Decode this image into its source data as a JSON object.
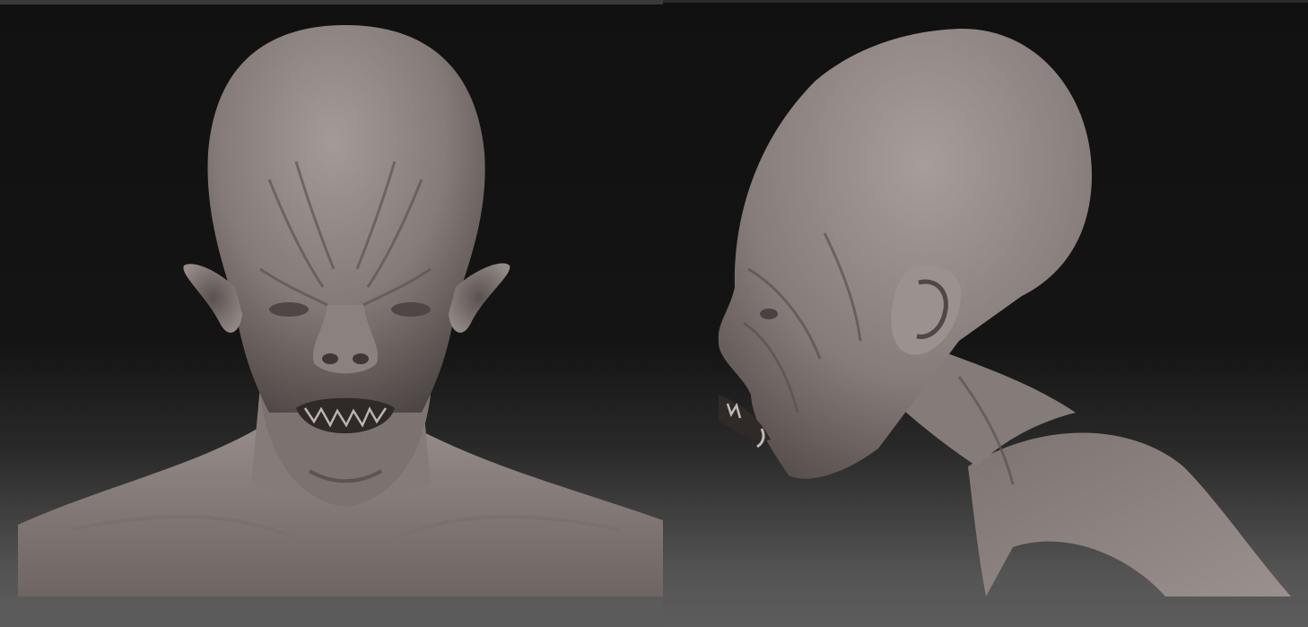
{
  "views": [
    {
      "name": "front-view"
    },
    {
      "name": "side-view"
    }
  ],
  "colors": {
    "clay": "#8a7f7c",
    "clay_light": "#a89f9c",
    "clay_dark": "#4a4240",
    "background_top": "#111111",
    "background_bottom": "#5c5c5c"
  }
}
